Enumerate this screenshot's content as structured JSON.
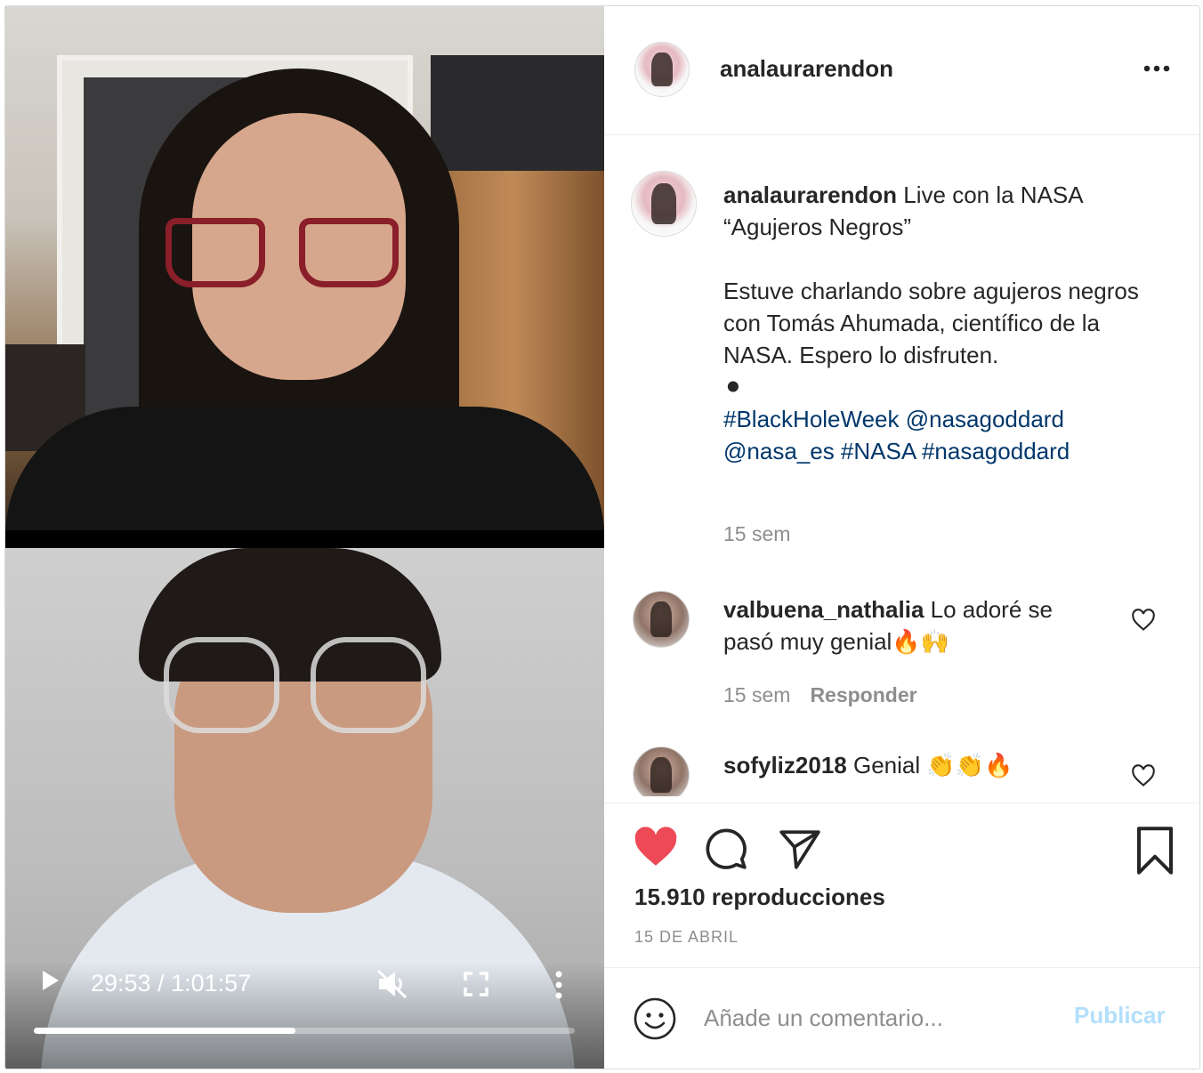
{
  "video": {
    "time_display": "29:53 / 1:01:57",
    "progress_fraction": 0.483
  },
  "post": {
    "username": "analaurarendon",
    "caption": {
      "username": "analaurarendon",
      "text": " Live con la NASA\n“Agujeros Negros”\n\nEstuve charlando sobre agujeros negros con Tomás Ahumada, científico de la NASA. Espero lo disfruten.\n⚫\n",
      "tags": "#BlackHoleWeek @nasagoddard @nasa_es #NASA #nasagoddard",
      "time": "15 sem"
    },
    "comments": [
      {
        "username": "valbuena_nathalia",
        "text": " Lo adoré se pasó muy genial🔥🙌",
        "time": "15 sem",
        "reply_label": "Responder"
      },
      {
        "username": "sofyliz2018",
        "text": " Genial 👏👏🔥"
      }
    ],
    "views": "15.910 reproducciones",
    "date": "15 DE ABRIL",
    "comment_placeholder": "Añade un comentario...",
    "publish_label": "Publicar"
  },
  "icons": {
    "like": "heart-filled-icon",
    "comment": "speech-bubble-icon",
    "share": "paper-plane-icon",
    "save": "bookmark-icon",
    "options": "more-horizontal-icon",
    "emoji": "smiley-icon"
  },
  "colors": {
    "like_red": "#ed4956",
    "hashtag_blue": "#00376b",
    "publish_disabled": "#b2dffc",
    "muted_text": "#8e8e8e"
  }
}
